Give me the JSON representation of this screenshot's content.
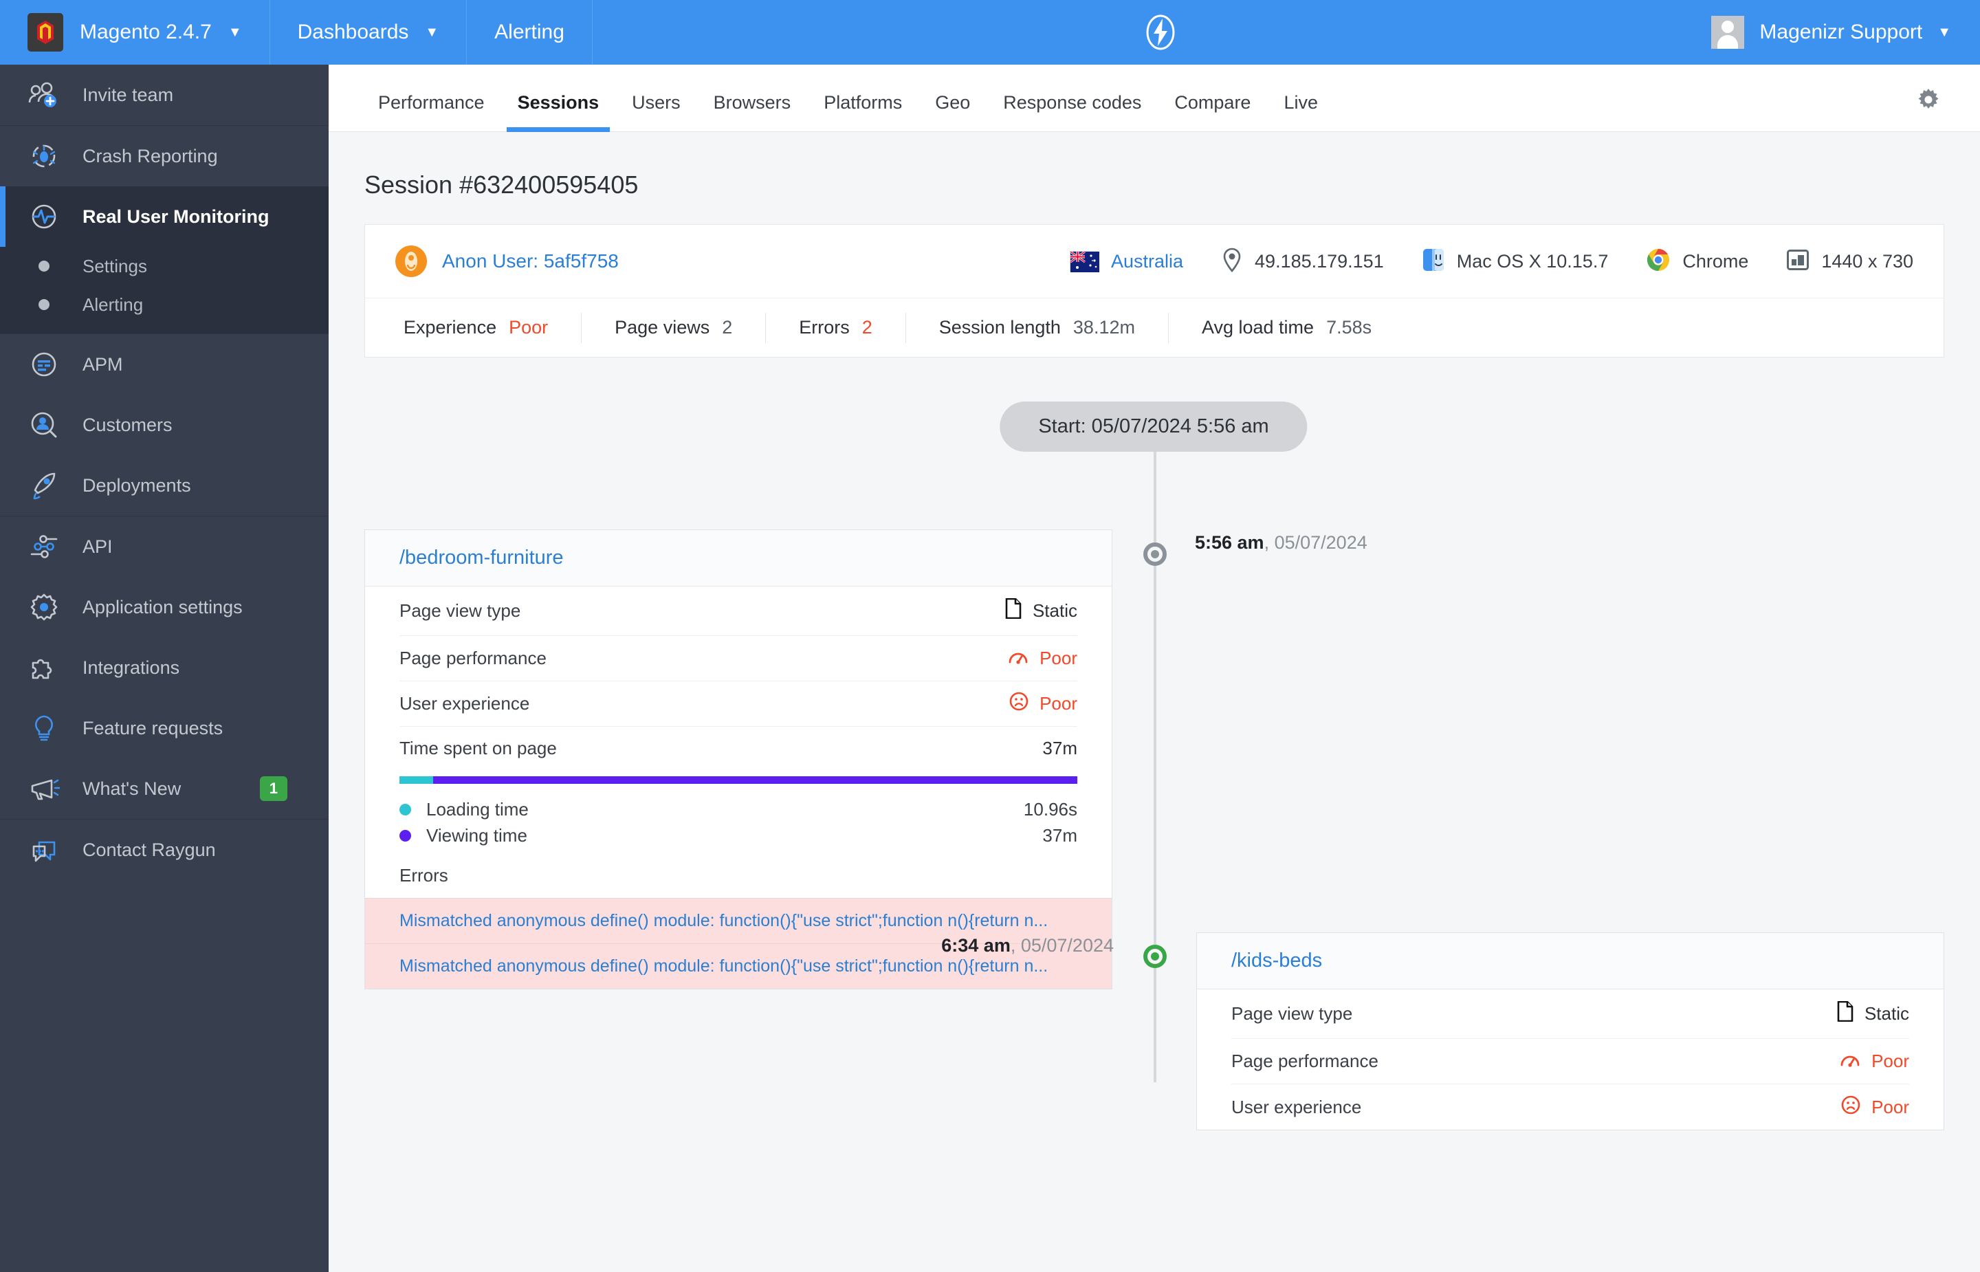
{
  "topbar": {
    "brand": "Magento 2.4.7",
    "brand_icon": "magento-logo-icon",
    "dashboards": "Dashboards",
    "alerting": "Alerting",
    "bolt_icon": "lightning-bolt-icon",
    "user_name": "Magenizr Support",
    "caret": "▼",
    "accent": "#3d92f0"
  },
  "sidebar": {
    "groups": [
      {
        "items": [
          {
            "label": "Invite team",
            "icon": "invite-team-icon",
            "active": false
          }
        ]
      },
      {
        "items": [
          {
            "label": "Crash Reporting",
            "icon": "crash-reporting-icon",
            "active": false
          },
          {
            "label": "Real User Monitoring",
            "icon": "real-user-monitoring-icon",
            "active": true
          }
        ],
        "subitems": [
          {
            "label": "Settings"
          },
          {
            "label": "Alerting"
          }
        ]
      },
      {
        "items": [
          {
            "label": "APM",
            "icon": "apm-icon",
            "active": false
          },
          {
            "label": "Customers",
            "icon": "customers-icon",
            "active": false
          },
          {
            "label": "Deployments",
            "icon": "deployments-icon",
            "active": false
          }
        ]
      },
      {
        "items": [
          {
            "label": "API",
            "icon": "api-icon",
            "active": false
          },
          {
            "label": "Application settings",
            "icon": "gear-icon",
            "active": false
          },
          {
            "label": "Integrations",
            "icon": "puzzle-icon",
            "active": false
          },
          {
            "label": "Feature requests",
            "icon": "lightbulb-icon",
            "active": false
          },
          {
            "label": "What's New",
            "icon": "megaphone-icon",
            "active": false,
            "badge": "1"
          }
        ]
      },
      {
        "items": [
          {
            "label": "Contact Raygun",
            "icon": "chat-icon",
            "active": false
          }
        ]
      }
    ],
    "badge_color": "#3aa648"
  },
  "tabs": [
    {
      "label": "Performance",
      "active": false
    },
    {
      "label": "Sessions",
      "active": true
    },
    {
      "label": "Users",
      "active": false
    },
    {
      "label": "Browsers",
      "active": false
    },
    {
      "label": "Platforms",
      "active": false
    },
    {
      "label": "Geo",
      "active": false
    },
    {
      "label": "Response codes",
      "active": false
    },
    {
      "label": "Compare",
      "active": false
    },
    {
      "label": "Live",
      "active": false
    }
  ],
  "settings_icon": "gear-icon",
  "page": {
    "title": "Session #632400595405"
  },
  "session": {
    "user_label": "Anon User: 5af5f758",
    "user_icon": "anon-user-icon",
    "country": "Australia",
    "country_flag": "australia-flag-icon",
    "ip": "49.185.179.151",
    "ip_icon": "location-pin-icon",
    "os": "Mac OS X 10.15.7",
    "os_icon": "macos-finder-icon",
    "browser": "Chrome",
    "browser_icon": "chrome-icon",
    "resolution": "1440 x 730",
    "resolution_icon": "screen-size-icon",
    "stats": [
      {
        "label": "Experience",
        "value": "Poor",
        "poor": true
      },
      {
        "label": "Page views",
        "value": "2",
        "poor": false
      },
      {
        "label": "Errors",
        "value": "2",
        "poor": true
      },
      {
        "label": "Session length",
        "value": "38.12m",
        "poor": false
      },
      {
        "label": "Avg load time",
        "value": "7.58s",
        "poor": false
      }
    ]
  },
  "timeline": {
    "start_label": "Start: 05/07/2024 5:56 am",
    "events": [
      {
        "time": "5:56 am",
        "date": "05/07/2024",
        "marker": "grey"
      },
      {
        "time": "6:34 am",
        "date": "05/07/2024",
        "marker": "green"
      }
    ]
  },
  "pageviews": [
    {
      "url": "/bedroom-furniture",
      "rows": [
        {
          "label": "Page view type",
          "value": "Static",
          "icon": "document-icon",
          "poor": false
        },
        {
          "label": "Page performance",
          "value": "Poor",
          "icon": "gauge-icon",
          "poor": true
        },
        {
          "label": "User experience",
          "value": "Poor",
          "icon": "sad-face-icon",
          "poor": true
        }
      ],
      "time_spent_label": "Time spent on page",
      "time_spent_value": "37m",
      "legend": [
        {
          "label": "Loading time",
          "value": "10.96s",
          "color": "#2ec5d3"
        },
        {
          "label": "Viewing time",
          "value": "37m",
          "color": "#5b20f0"
        }
      ],
      "bar_loading_pct": 5,
      "errors_label": "Errors",
      "errors": [
        "Mismatched anonymous define() module: function(){\"use strict\";function n(){return n...",
        "Mismatched anonymous define() module: function(){\"use strict\";function n(){return n..."
      ]
    },
    {
      "url": "/kids-beds",
      "rows": [
        {
          "label": "Page view type",
          "value": "Static",
          "icon": "document-icon",
          "poor": false
        },
        {
          "label": "Page performance",
          "value": "Poor",
          "icon": "gauge-icon",
          "poor": true
        },
        {
          "label": "User experience",
          "value": "Poor",
          "icon": "sad-face-icon",
          "poor": true
        }
      ]
    }
  ]
}
